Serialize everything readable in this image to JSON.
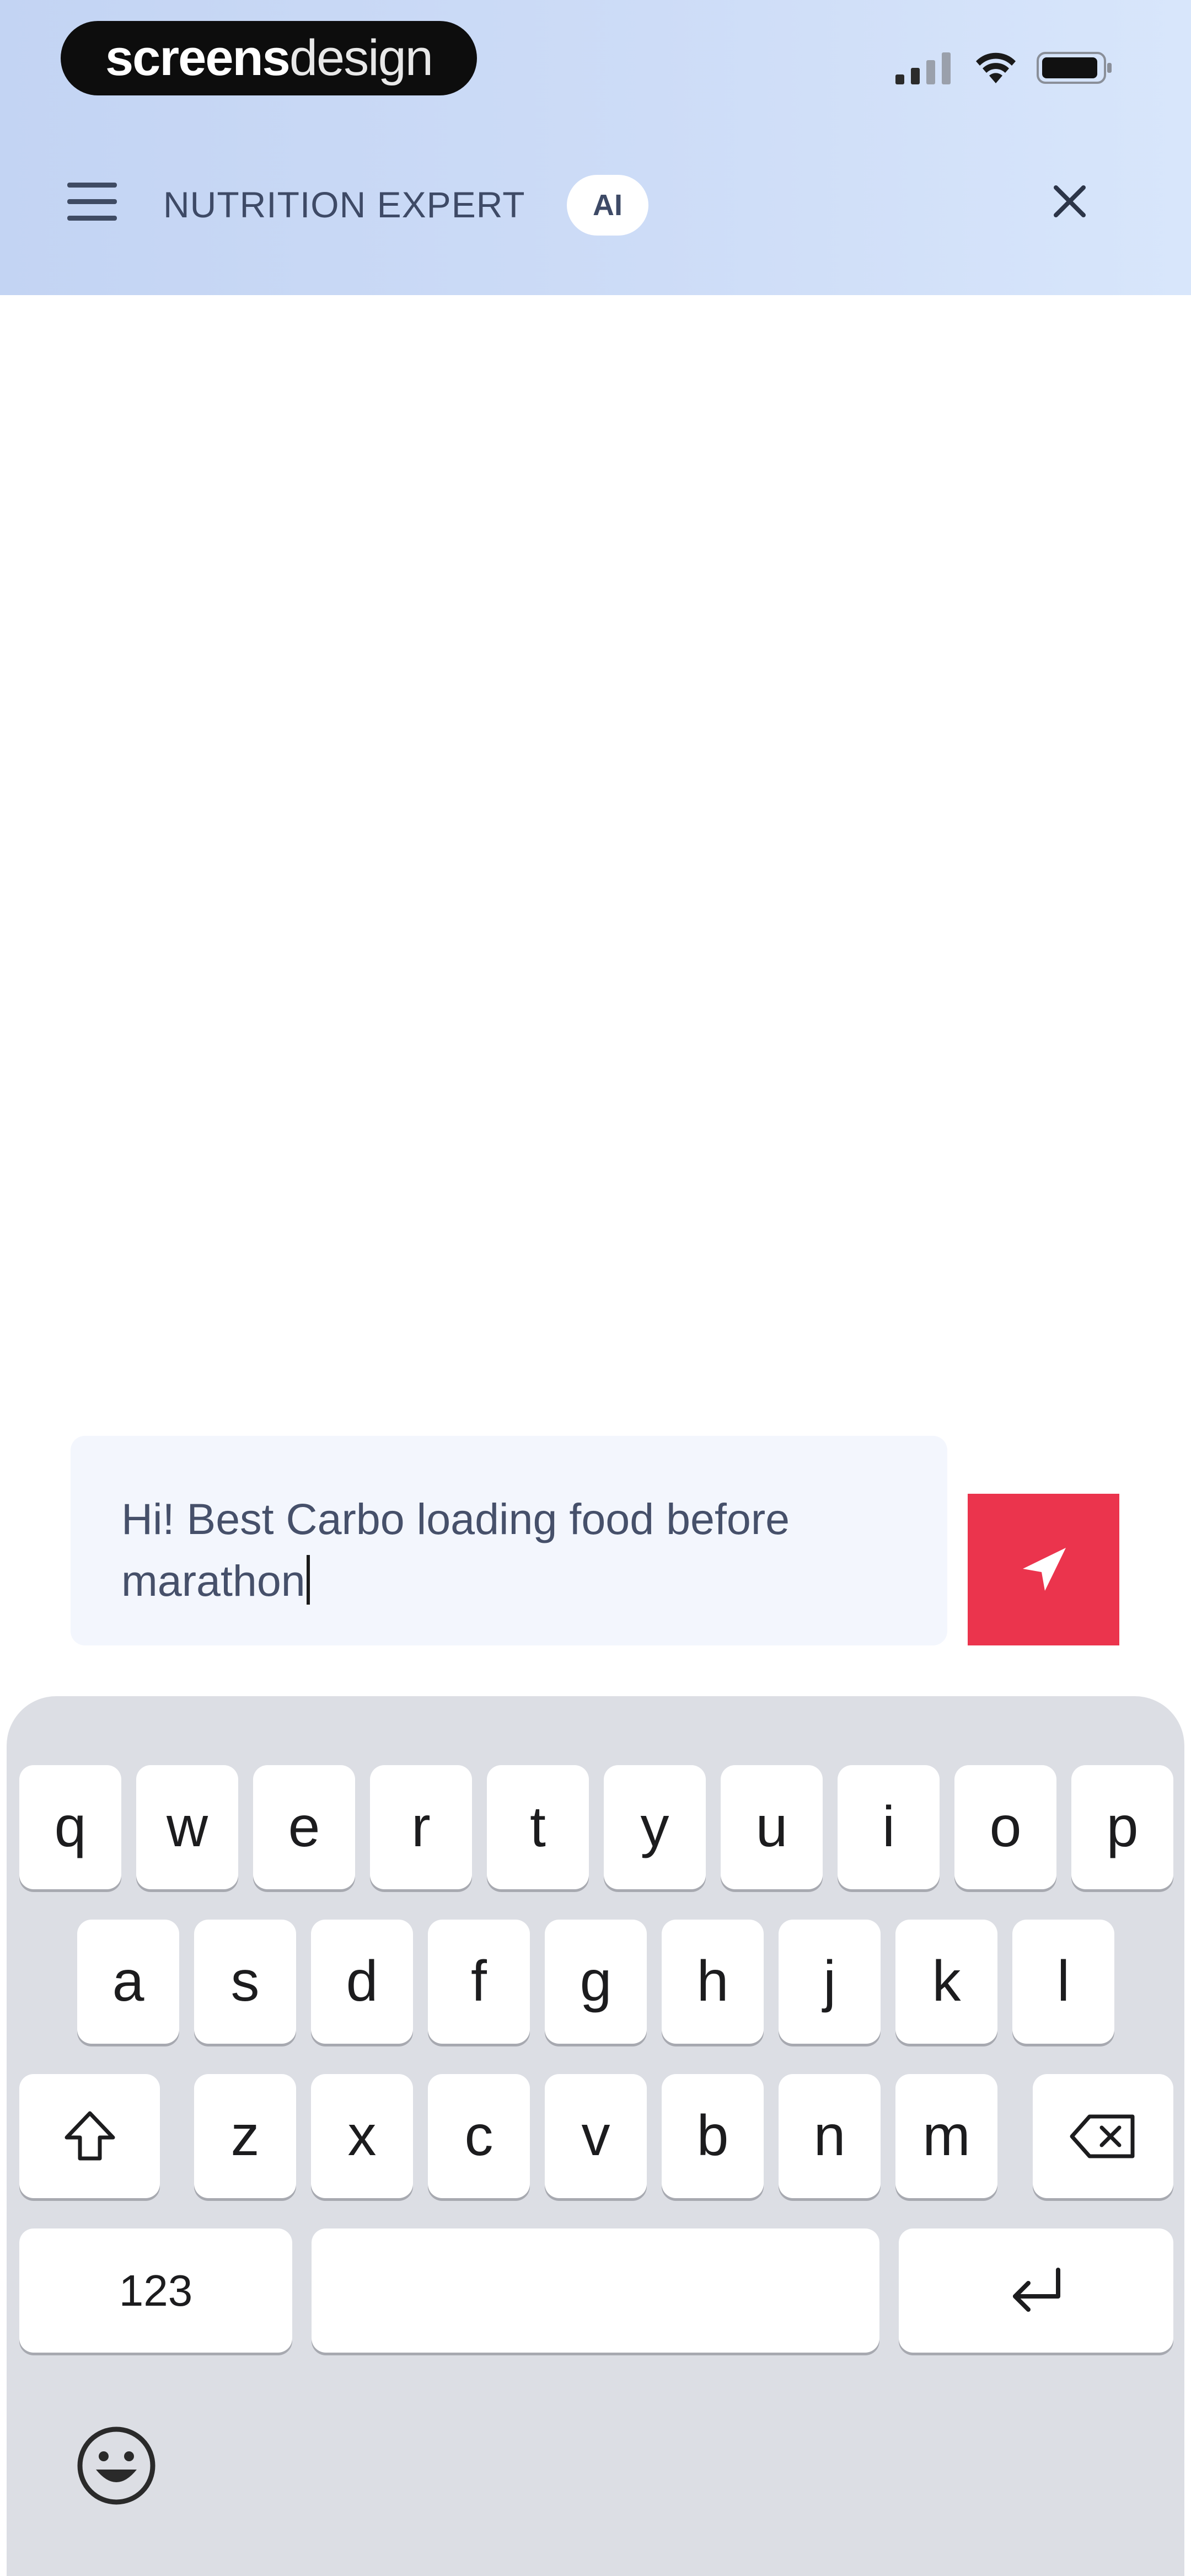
{
  "status_bar": {
    "brand_bold": "screens",
    "brand_light": "design",
    "signal_icon": "signal-bars-icon",
    "wifi_icon": "wifi-icon",
    "battery_icon": "battery-icon"
  },
  "header": {
    "menu_icon": "hamburger-menu-icon",
    "title": "NUTRITION EXPERT",
    "badge": "AI",
    "close_icon": "close-icon"
  },
  "composer": {
    "input_value": "Hi! Best Carbo loading food before marathon",
    "send_icon": "send-arrow-icon"
  },
  "keyboard": {
    "row1": [
      "q",
      "w",
      "e",
      "r",
      "t",
      "y",
      "u",
      "i",
      "o",
      "p"
    ],
    "row2": [
      "a",
      "s",
      "d",
      "f",
      "g",
      "h",
      "j",
      "k",
      "l"
    ],
    "row3": [
      "z",
      "x",
      "c",
      "v",
      "b",
      "n",
      "m"
    ],
    "numbers_label": "123",
    "shift_icon": "shift-icon",
    "backspace_icon": "backspace-icon",
    "return_icon": "return-icon",
    "emoji_icon": "emoji-icon"
  },
  "colors": {
    "header_bg": "#c8d8f5",
    "send_button": "#eb344d",
    "input_bg": "#f3f6fd",
    "keyboard_bg": "#dcdee4",
    "title_text": "#3e4a66"
  }
}
